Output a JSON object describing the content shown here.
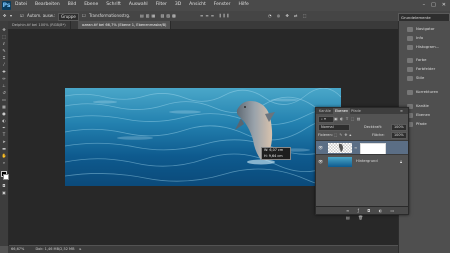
{
  "menubar": {
    "logo": "Ps",
    "items": [
      "Datei",
      "Bearbeiten",
      "Bild",
      "Ebene",
      "Schrift",
      "Auswahl",
      "Filter",
      "3D",
      "Ansicht",
      "Fenster",
      "Hilfe"
    ]
  },
  "options": {
    "autoselect_label": "Autom. ausw.:",
    "autoselect_value": "Gruppe",
    "transform_label": "Transformationsstrg."
  },
  "workspace": {
    "value": "Grundelemente"
  },
  "doc_tabs": [
    {
      "label": "Delphin.tif bei 100% (RGB/8*)"
    },
    {
      "label": "ozean.tif bei 66,7% (Ebene 1, Ebenenmaske/8)"
    }
  ],
  "statusbar": {
    "zoom": "66,67%",
    "doc": "Dok: 1,46 MB/2,52 MB"
  },
  "tooltip": {
    "w": "W: 6,07 cm",
    "h": "H: 9,64 cm"
  },
  "right_panels": [
    {
      "label": "Navigator",
      "icon": "navigator-icon"
    },
    {
      "label": "Info",
      "icon": "info-icon"
    },
    {
      "label": "Histogram...",
      "icon": "histogram-icon"
    },
    {
      "label": "Farbe",
      "icon": "color-icon"
    },
    {
      "label": "Farbfelder",
      "icon": "swatches-icon"
    },
    {
      "label": "Stile",
      "icon": "styles-icon"
    },
    {
      "label": "Korrekturen",
      "icon": "adjustments-icon"
    },
    {
      "label": "Kanäle",
      "icon": "channels-icon"
    },
    {
      "label": "Ebenen",
      "icon": "layers-icon"
    },
    {
      "label": "Pfade",
      "icon": "paths-icon"
    }
  ],
  "layers_panel": {
    "tabs": [
      "Kanäle",
      "Ebenen",
      "Pfade"
    ],
    "active_tab": "Ebenen",
    "blend_mode": "Normal",
    "opacity_label": "Deckkraft:",
    "opacity_value": "100%",
    "fill_label": "Fläche:",
    "fill_value": "100%",
    "lock_label": "Fixieren:",
    "layers": [
      {
        "name": "",
        "selected": true
      },
      {
        "name": "Hintergrund",
        "selected": false
      }
    ]
  },
  "colors": {
    "accent": "#5b6e85",
    "panel": "#535353",
    "canvas": "#282828"
  }
}
